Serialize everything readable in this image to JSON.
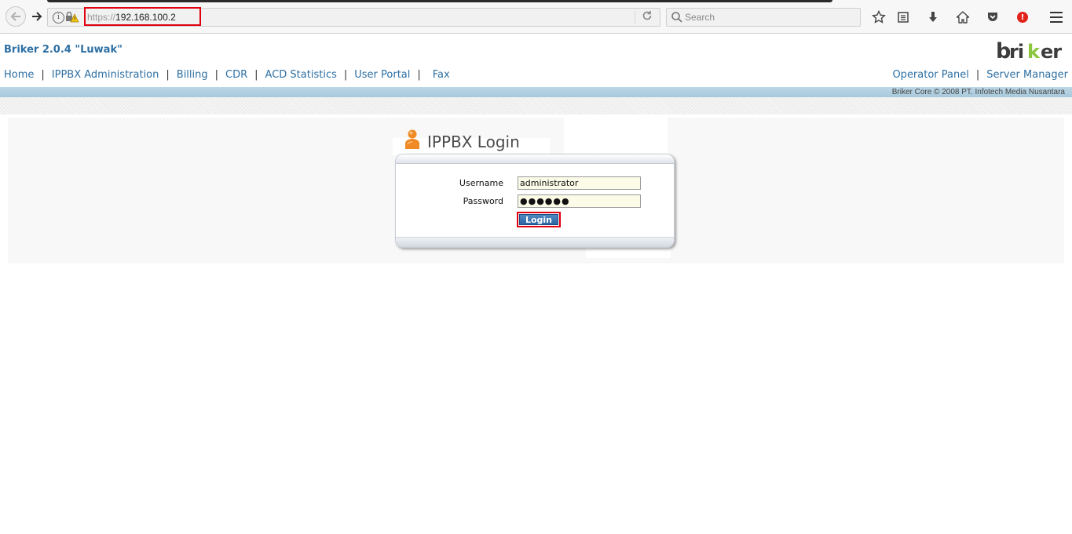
{
  "browser": {
    "url_scheme": "https://",
    "url_host": "192.168.100.2",
    "search_placeholder": "Search",
    "icons": [
      "back-arrow-icon",
      "forward-arrow-icon",
      "info-icon",
      "insecure-lock-icon",
      "reload-icon",
      "search-icon",
      "bookmark-star-icon",
      "reading-list-icon",
      "download-icon",
      "home-icon",
      "pocket-icon",
      "alert-icon",
      "hamburger-menu-icon"
    ],
    "alert_symbol": "!",
    "accent_color": "#e0000f"
  },
  "header": {
    "site_title": "Briker 2.0.4 \"Luwak\"",
    "logo_text": "briker",
    "nav_items": [
      "Home",
      "IPPBX Administration",
      "Billing",
      "CDR",
      "ACD Statistics",
      "User Portal",
      "Fax"
    ],
    "nav_separator": "|",
    "right_nav_items": [
      "Operator Panel",
      "Server Manager"
    ],
    "copyright": "Briker Core © 2008 PT. Infotech Media Nusantara",
    "link_color": "#2d6fa3"
  },
  "login": {
    "title": "IPPBX Login",
    "username_label": "Username",
    "username_value": "administrator",
    "password_label": "Password",
    "password_masked": "●●●●●●",
    "submit_label": "Login"
  }
}
